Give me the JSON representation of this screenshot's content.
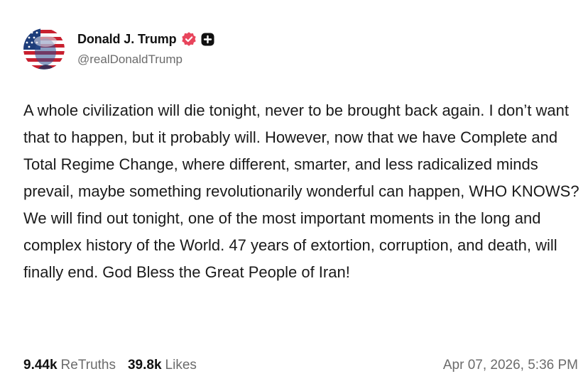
{
  "author": {
    "display_name": "Donald J. Trump",
    "handle": "@realDonaldTrump",
    "verified_icon": "verified-badge-icon",
    "verified_color": "#e8455c",
    "plus_icon": "plus-square-icon"
  },
  "post": {
    "text": "A whole civilization will die tonight, never to be brought back again. I don’t want that to happen, but it probably will. However, now that we have Complete and Total Regime Change, where different, smarter, and less radicalized minds prevail, maybe something revolutionarily wonderful can happen, WHO KNOWS? We will find out tonight, one of the most important moments in the long and complex history of the World. 47 years of extortion, corruption, and death, will finally end. God Bless the Great People of Iran!"
  },
  "stats": {
    "retruths_count": "9.44k",
    "retruths_label": "ReTruths",
    "likes_count": "39.8k",
    "likes_label": "Likes"
  },
  "timestamp": "Apr 07, 2026, 5:36 PM"
}
